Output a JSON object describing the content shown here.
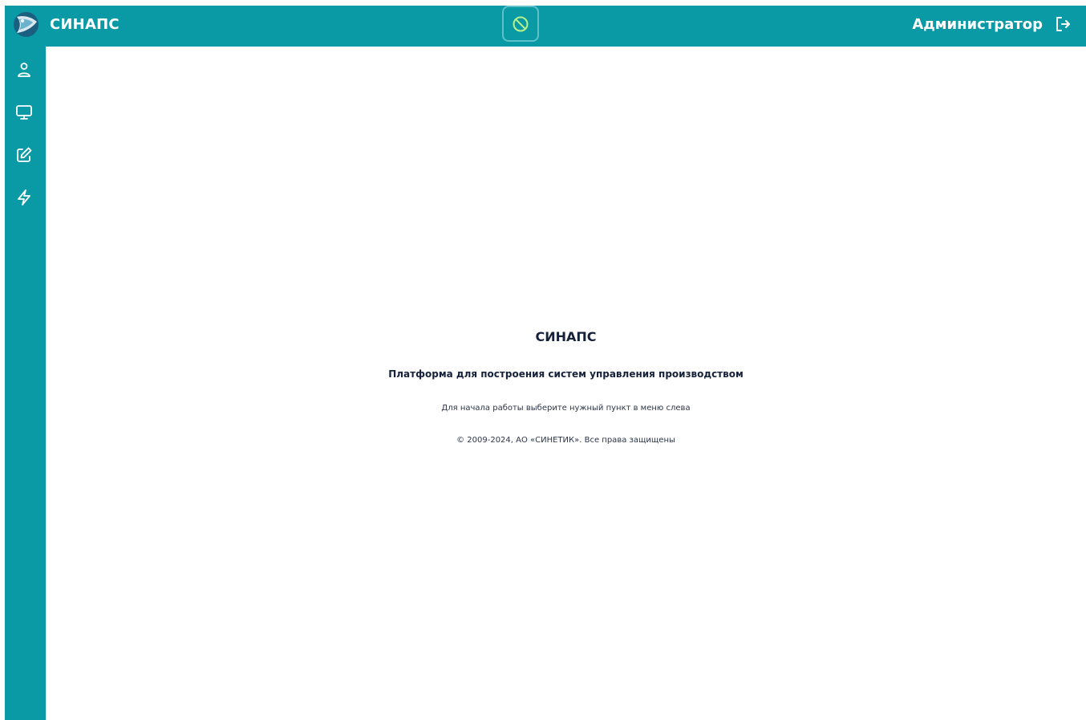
{
  "header": {
    "app_title": "СИНАПС",
    "user_name": "Администратор",
    "logo_icon": "synaps-logo-icon",
    "status_icon": "prohibited-icon",
    "logout_icon": "logout-icon"
  },
  "sidebar": {
    "items": [
      {
        "name": "users",
        "icon": "user-icon"
      },
      {
        "name": "monitors",
        "icon": "monitor-icon"
      },
      {
        "name": "editor",
        "icon": "edit-icon"
      },
      {
        "name": "events",
        "icon": "lightning-icon"
      }
    ]
  },
  "main": {
    "title": "СИНАПС",
    "subtitle": "Платформа для построения систем управления производством",
    "hint": "Для начала работы выберите нужный пункт в меню слева",
    "copyright": "© 2009-2024, АО «СИНЕТИК». Все права защищены"
  },
  "colors": {
    "brand": "#0a9aa6",
    "status_icon": "#b9f28a",
    "text_dark": "#16213a"
  }
}
